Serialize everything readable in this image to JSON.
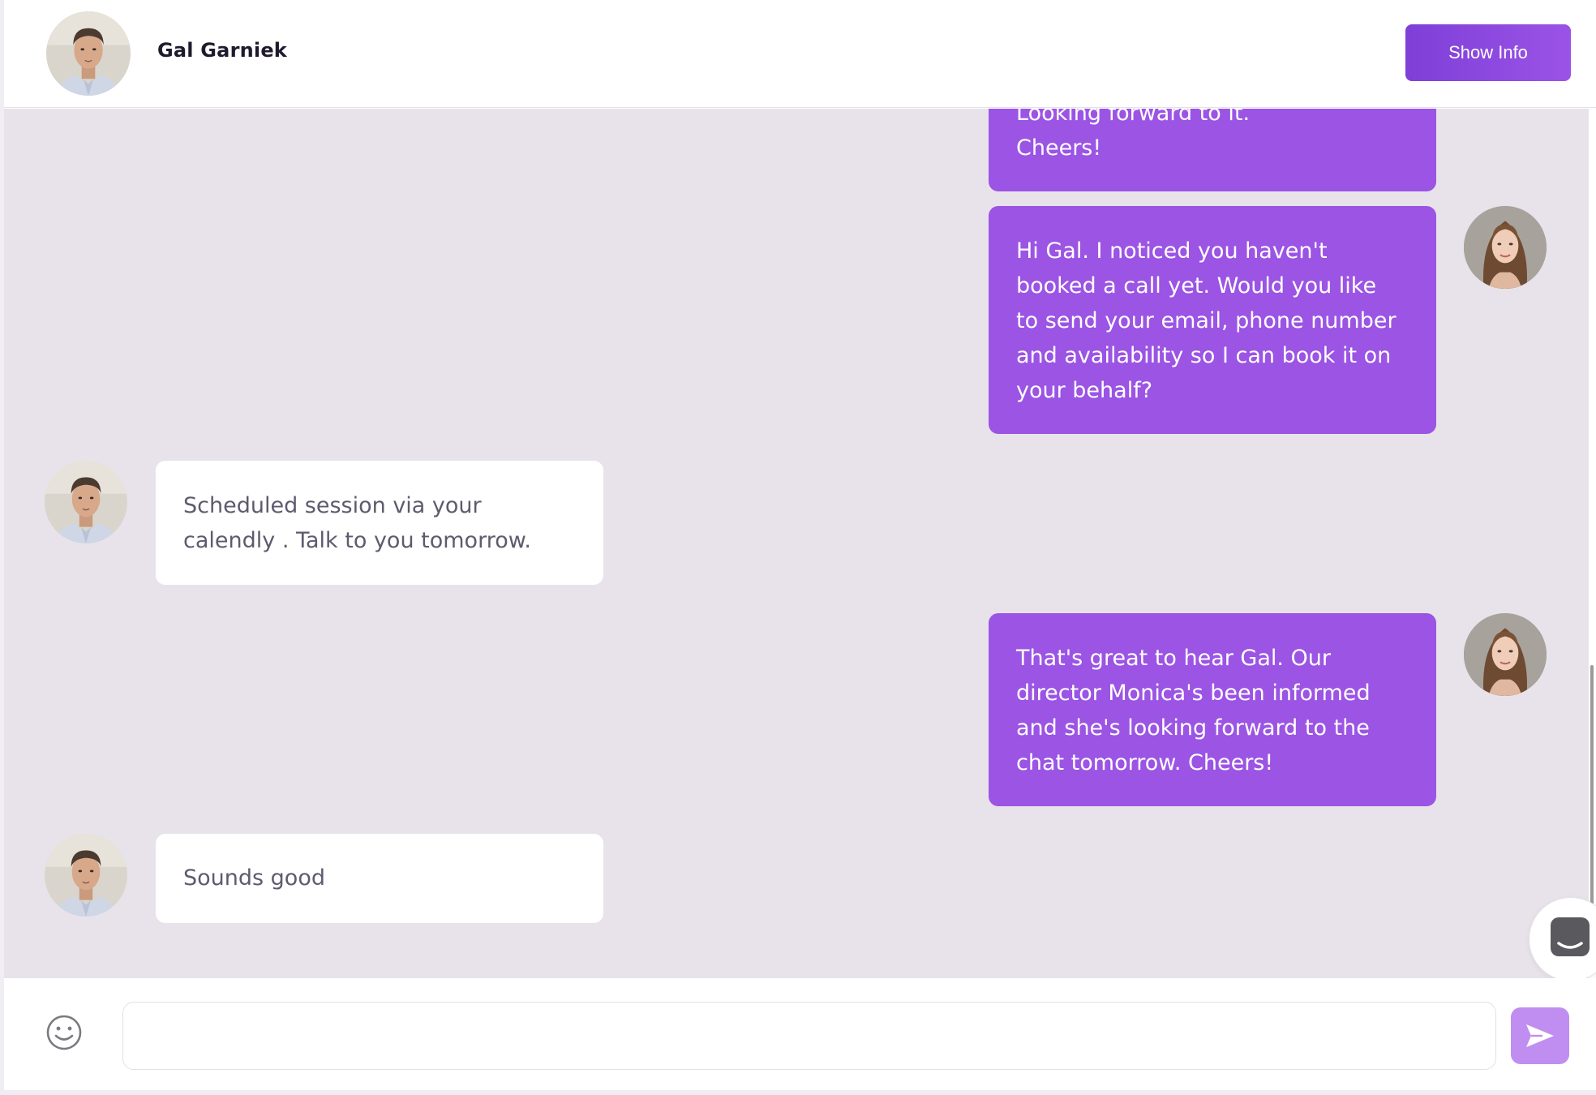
{
  "header": {
    "contact_name": "Gal Garniek",
    "show_info_label": "Show Info"
  },
  "messages": [
    {
      "direction": "outgoing",
      "sender": "agent",
      "lines": [
        "Looking forward to it.",
        "Cheers!"
      ]
    },
    {
      "direction": "outgoing",
      "sender": "agent",
      "lines": [
        "Hi Gal. I noticed you haven't",
        "booked a call yet. Would you  like",
        "to send your email, phone number",
        "and availability so I can book it on",
        "your behalf?"
      ]
    },
    {
      "direction": "incoming",
      "sender": "Gal Garniek",
      "lines": [
        "Scheduled session via your",
        "calendly . Talk to you tomorrow."
      ]
    },
    {
      "direction": "outgoing",
      "sender": "agent",
      "lines": [
        "That's great to hear Gal. Our",
        "director Monica's been informed",
        "and she's looking forward to the",
        "chat tomorrow. Cheers!"
      ]
    },
    {
      "direction": "incoming",
      "sender": "Gal Garniek",
      "lines": [
        "Sounds good"
      ]
    }
  ],
  "composer": {
    "input_value": "",
    "input_placeholder": "",
    "emoji_icon": "smiley-icon",
    "send_icon": "send-arrow-icon"
  },
  "help_widget": {
    "icon": "chat-bubble-icon"
  },
  "colors": {
    "accent": "#9b54e4",
    "header_button": "#8a48e0",
    "send_button": "#c08ef0",
    "chat_background": "#e8e3ea",
    "incoming_bubble": "#ffffff",
    "incoming_text": "#5f5a6e"
  }
}
